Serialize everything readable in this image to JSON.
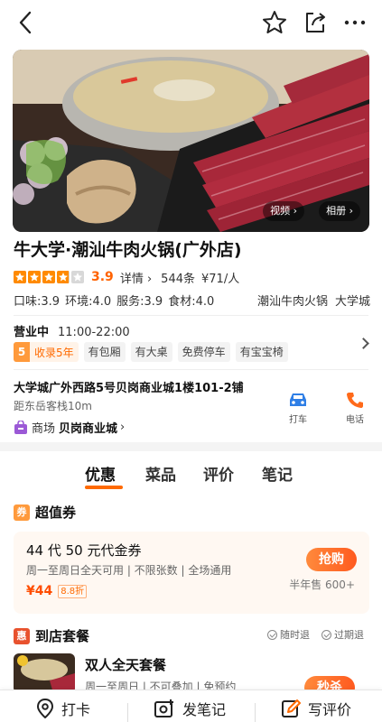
{
  "header": {
    "icons": [
      "back-icon",
      "star-outline-icon",
      "share-icon",
      "more-icon"
    ]
  },
  "hero": {
    "video_label": "视频",
    "album_label": "相册"
  },
  "shop": {
    "name": "牛大学·潮汕牛肉火锅(广外店)",
    "rating": 3.9,
    "rating_text": "3.9",
    "details_label": "详情",
    "reviews": "544条",
    "avg_price": "¥71/人",
    "subscores": {
      "taste": "口味:3.9",
      "env": "环境:4.0",
      "service": "服务:3.9",
      "ingredients": "食材:4.0"
    },
    "category": "潮汕牛肉火锅",
    "area": "大学城"
  },
  "hours": {
    "status": "营业中",
    "time": "11:00-22:00"
  },
  "tags": {
    "badge_num": "5",
    "badge_text": "收录5年",
    "items": [
      "有包厢",
      "有大桌",
      "免费停车",
      "有宝宝椅"
    ]
  },
  "location": {
    "address": "大学城广外西路5号贝岗商业城1楼101-2铺",
    "distance": "距东岳客栈10m",
    "mall_prefix": "商场",
    "mall_name": "贝岗商业城",
    "taxi_label": "打车",
    "phone_label": "电话"
  },
  "tabs": [
    "优惠",
    "菜品",
    "评价",
    "笔记"
  ],
  "active_tab": 0,
  "voucher_section": {
    "badge": "券",
    "title": "超值券",
    "coupon": {
      "title": "44 代 50 元代金券",
      "conditions": "周一至周日全天可用 | 不限张数 | 全场通用",
      "price": "¥44",
      "discount": "8.8折",
      "button": "抢购",
      "sold": "半年售 600+"
    }
  },
  "package_section": {
    "badge": "惠",
    "title": "到店套餐",
    "refund_any": "随时退",
    "refund_expired": "过期退",
    "item": {
      "name": "双人全天套餐",
      "conditions": "周一至周日 | 不可叠加 | 免预约",
      "button": "秒杀"
    }
  },
  "bottom": {
    "checkin": "打卡",
    "note": "发笔记",
    "review": "写评价"
  },
  "colors": {
    "accent": "#ff6a00",
    "star": "#ff8a00",
    "voucher_badge": "#ff9a3c",
    "package_badge": "#e8522e"
  }
}
